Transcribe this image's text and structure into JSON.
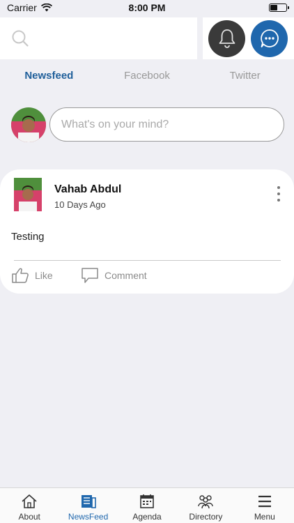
{
  "status_bar": {
    "carrier": "Carrier",
    "time": "8:00 PM"
  },
  "search": {
    "placeholder": ""
  },
  "tabs": [
    {
      "label": "Newsfeed",
      "active": true
    },
    {
      "label": "Facebook",
      "active": false
    },
    {
      "label": "Twitter",
      "active": false
    }
  ],
  "composer": {
    "placeholder": "What's on your mind?"
  },
  "post": {
    "author": "Vahab Abdul",
    "time": "10 Days Ago",
    "text": "Testing",
    "like_label": "Like",
    "comment_label": "Comment"
  },
  "nav": [
    {
      "label": "About",
      "icon": "house-icon"
    },
    {
      "label": "NewsFeed",
      "icon": "newspaper-icon"
    },
    {
      "label": "Agenda",
      "icon": "calendar-icon"
    },
    {
      "label": "Directory",
      "icon": "people-icon"
    },
    {
      "label": "Menu",
      "icon": "hamburger-icon"
    }
  ],
  "colors": {
    "accent": "#1f67ad",
    "background": "#efeff4",
    "bell_button": "#3a3a3a"
  }
}
